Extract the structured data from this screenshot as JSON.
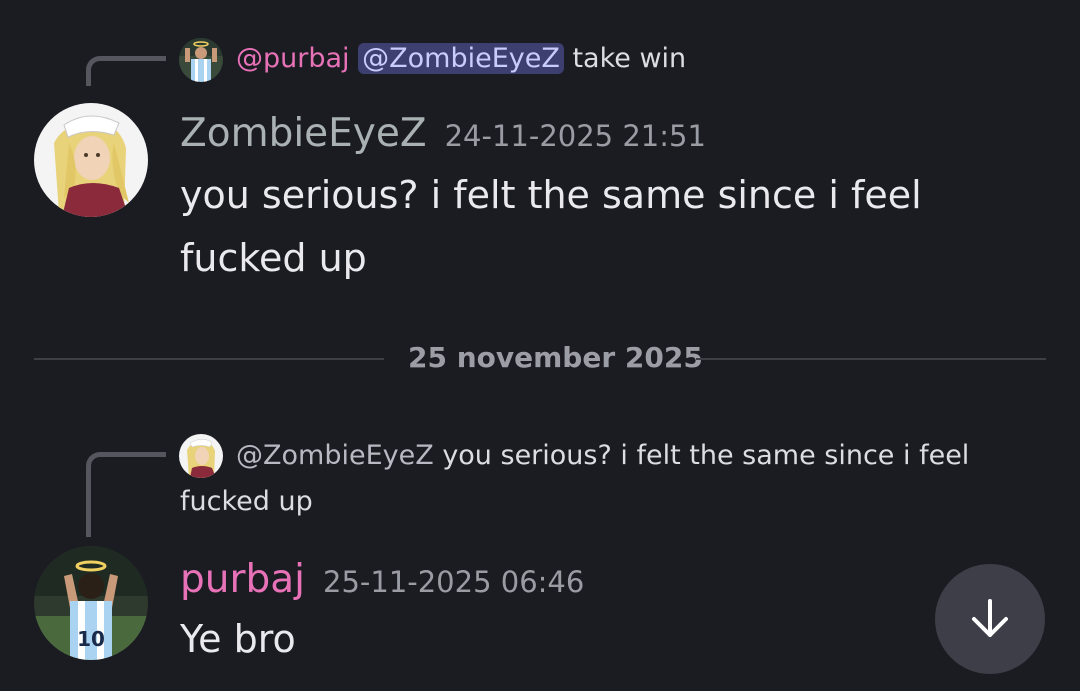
{
  "messages": [
    {
      "reply": {
        "author_mention": "@purbaj",
        "target_mention": "@ZombieEyeZ",
        "text": "take win",
        "avatar_icon": "football-player-avatar-icon"
      },
      "author": "ZombieEyeZ",
      "timestamp": "24-11-2025 21:51",
      "text_line1": "you serious? i felt the same since i feel",
      "text_line2": "fucked up",
      "avatar_icon": "anime-character-avatar-icon",
      "name_color": "#a9b1b3"
    },
    {
      "reply": {
        "author_mention": "@ZombieEyeZ",
        "text_line1": "you serious? i felt the same since i feel",
        "text_line2": "fucked up",
        "avatar_icon": "anime-character-avatar-icon"
      },
      "author": "purbaj",
      "timestamp": "25-11-2025 06:46",
      "text": "Ye bro",
      "avatar_icon": "football-player-avatar-icon",
      "name_color": "#e872b8"
    }
  ],
  "date_divider": {
    "label": "25 november 2025"
  },
  "jump_button": {
    "icon": "arrow-down-icon"
  },
  "colors": {
    "background": "#1b1b22",
    "mention_pink": "#e872b8",
    "mention_pill_bg": "#3c3f70"
  }
}
